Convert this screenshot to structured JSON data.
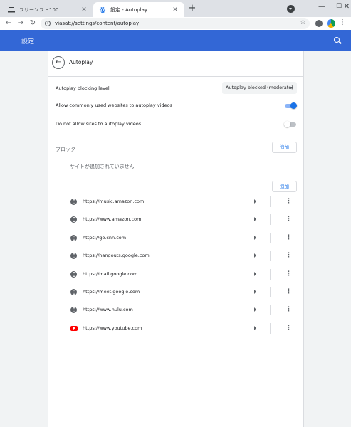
{
  "browser": {
    "tabs": [
      {
        "title": "フリーソフト100",
        "icon": "laptop-icon",
        "active": false
      },
      {
        "title": "設定 - Autoplay",
        "icon": "gear-icon",
        "active": true
      }
    ],
    "new_tab_glyph": "+",
    "window_controls": {
      "minimize": "—",
      "maximize": "☐",
      "close": "✕"
    },
    "url": "viasat://settings/content/autoplay"
  },
  "settings_header": {
    "title": "設定"
  },
  "page": {
    "title": "Autoplay",
    "blocking_level": {
      "label": "Autoplay blocking level",
      "selected": "Autoplay blocked (moderate)"
    },
    "allow_common_sites": {
      "label": "Allow commonly used websites to autoplay videos",
      "enabled": true
    },
    "do_not_allow": {
      "label": "Do not allow sites to autoplay videos",
      "enabled": false
    },
    "block_section": {
      "label": "ブロック",
      "add_label": "追加",
      "empty_message": "サイトが追加されていません"
    },
    "allow_section": {
      "add_label": "追加",
      "sites": [
        {
          "url": "https://music.amazon.com",
          "icon": "globe-icon"
        },
        {
          "url": "https://www.amazon.com",
          "icon": "globe-icon"
        },
        {
          "url": "https://go.cnn.com",
          "icon": "globe-icon"
        },
        {
          "url": "https://hangouts.google.com",
          "icon": "globe-icon"
        },
        {
          "url": "https://mail.google.com",
          "icon": "globe-icon"
        },
        {
          "url": "https://meet.google.com",
          "icon": "globe-icon"
        },
        {
          "url": "https://www.hulu.com",
          "icon": "globe-icon"
        },
        {
          "url": "https://www.youtube.com",
          "icon": "youtube-icon"
        }
      ]
    }
  },
  "colors": {
    "header_blue": "#3367d6",
    "accent": "#1a73e8"
  }
}
